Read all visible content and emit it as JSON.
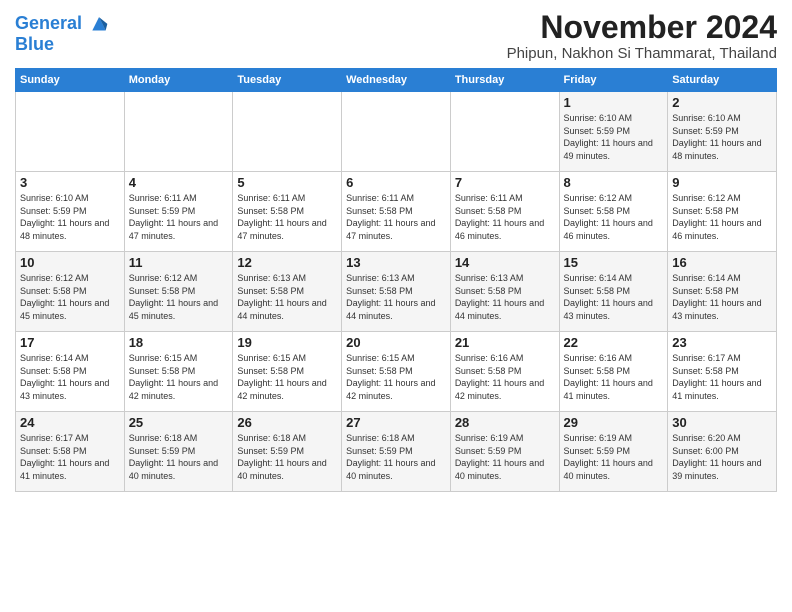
{
  "logo": {
    "line1": "General",
    "line2": "Blue"
  },
  "title": "November 2024",
  "subtitle": "Phipun, Nakhon Si Thammarat, Thailand",
  "days_of_week": [
    "Sunday",
    "Monday",
    "Tuesday",
    "Wednesday",
    "Thursday",
    "Friday",
    "Saturday"
  ],
  "weeks": [
    [
      {
        "day": "",
        "info": ""
      },
      {
        "day": "",
        "info": ""
      },
      {
        "day": "",
        "info": ""
      },
      {
        "day": "",
        "info": ""
      },
      {
        "day": "",
        "info": ""
      },
      {
        "day": "1",
        "info": "Sunrise: 6:10 AM\nSunset: 5:59 PM\nDaylight: 11 hours and 49 minutes."
      },
      {
        "day": "2",
        "info": "Sunrise: 6:10 AM\nSunset: 5:59 PM\nDaylight: 11 hours and 48 minutes."
      }
    ],
    [
      {
        "day": "3",
        "info": "Sunrise: 6:10 AM\nSunset: 5:59 PM\nDaylight: 11 hours and 48 minutes."
      },
      {
        "day": "4",
        "info": "Sunrise: 6:11 AM\nSunset: 5:59 PM\nDaylight: 11 hours and 47 minutes."
      },
      {
        "day": "5",
        "info": "Sunrise: 6:11 AM\nSunset: 5:58 PM\nDaylight: 11 hours and 47 minutes."
      },
      {
        "day": "6",
        "info": "Sunrise: 6:11 AM\nSunset: 5:58 PM\nDaylight: 11 hours and 47 minutes."
      },
      {
        "day": "7",
        "info": "Sunrise: 6:11 AM\nSunset: 5:58 PM\nDaylight: 11 hours and 46 minutes."
      },
      {
        "day": "8",
        "info": "Sunrise: 6:12 AM\nSunset: 5:58 PM\nDaylight: 11 hours and 46 minutes."
      },
      {
        "day": "9",
        "info": "Sunrise: 6:12 AM\nSunset: 5:58 PM\nDaylight: 11 hours and 46 minutes."
      }
    ],
    [
      {
        "day": "10",
        "info": "Sunrise: 6:12 AM\nSunset: 5:58 PM\nDaylight: 11 hours and 45 minutes."
      },
      {
        "day": "11",
        "info": "Sunrise: 6:12 AM\nSunset: 5:58 PM\nDaylight: 11 hours and 45 minutes."
      },
      {
        "day": "12",
        "info": "Sunrise: 6:13 AM\nSunset: 5:58 PM\nDaylight: 11 hours and 44 minutes."
      },
      {
        "day": "13",
        "info": "Sunrise: 6:13 AM\nSunset: 5:58 PM\nDaylight: 11 hours and 44 minutes."
      },
      {
        "day": "14",
        "info": "Sunrise: 6:13 AM\nSunset: 5:58 PM\nDaylight: 11 hours and 44 minutes."
      },
      {
        "day": "15",
        "info": "Sunrise: 6:14 AM\nSunset: 5:58 PM\nDaylight: 11 hours and 43 minutes."
      },
      {
        "day": "16",
        "info": "Sunrise: 6:14 AM\nSunset: 5:58 PM\nDaylight: 11 hours and 43 minutes."
      }
    ],
    [
      {
        "day": "17",
        "info": "Sunrise: 6:14 AM\nSunset: 5:58 PM\nDaylight: 11 hours and 43 minutes."
      },
      {
        "day": "18",
        "info": "Sunrise: 6:15 AM\nSunset: 5:58 PM\nDaylight: 11 hours and 42 minutes."
      },
      {
        "day": "19",
        "info": "Sunrise: 6:15 AM\nSunset: 5:58 PM\nDaylight: 11 hours and 42 minutes."
      },
      {
        "day": "20",
        "info": "Sunrise: 6:15 AM\nSunset: 5:58 PM\nDaylight: 11 hours and 42 minutes."
      },
      {
        "day": "21",
        "info": "Sunrise: 6:16 AM\nSunset: 5:58 PM\nDaylight: 11 hours and 42 minutes."
      },
      {
        "day": "22",
        "info": "Sunrise: 6:16 AM\nSunset: 5:58 PM\nDaylight: 11 hours and 41 minutes."
      },
      {
        "day": "23",
        "info": "Sunrise: 6:17 AM\nSunset: 5:58 PM\nDaylight: 11 hours and 41 minutes."
      }
    ],
    [
      {
        "day": "24",
        "info": "Sunrise: 6:17 AM\nSunset: 5:58 PM\nDaylight: 11 hours and 41 minutes."
      },
      {
        "day": "25",
        "info": "Sunrise: 6:18 AM\nSunset: 5:59 PM\nDaylight: 11 hours and 40 minutes."
      },
      {
        "day": "26",
        "info": "Sunrise: 6:18 AM\nSunset: 5:59 PM\nDaylight: 11 hours and 40 minutes."
      },
      {
        "day": "27",
        "info": "Sunrise: 6:18 AM\nSunset: 5:59 PM\nDaylight: 11 hours and 40 minutes."
      },
      {
        "day": "28",
        "info": "Sunrise: 6:19 AM\nSunset: 5:59 PM\nDaylight: 11 hours and 40 minutes."
      },
      {
        "day": "29",
        "info": "Sunrise: 6:19 AM\nSunset: 5:59 PM\nDaylight: 11 hours and 40 minutes."
      },
      {
        "day": "30",
        "info": "Sunrise: 6:20 AM\nSunset: 6:00 PM\nDaylight: 11 hours and 39 minutes."
      }
    ]
  ]
}
